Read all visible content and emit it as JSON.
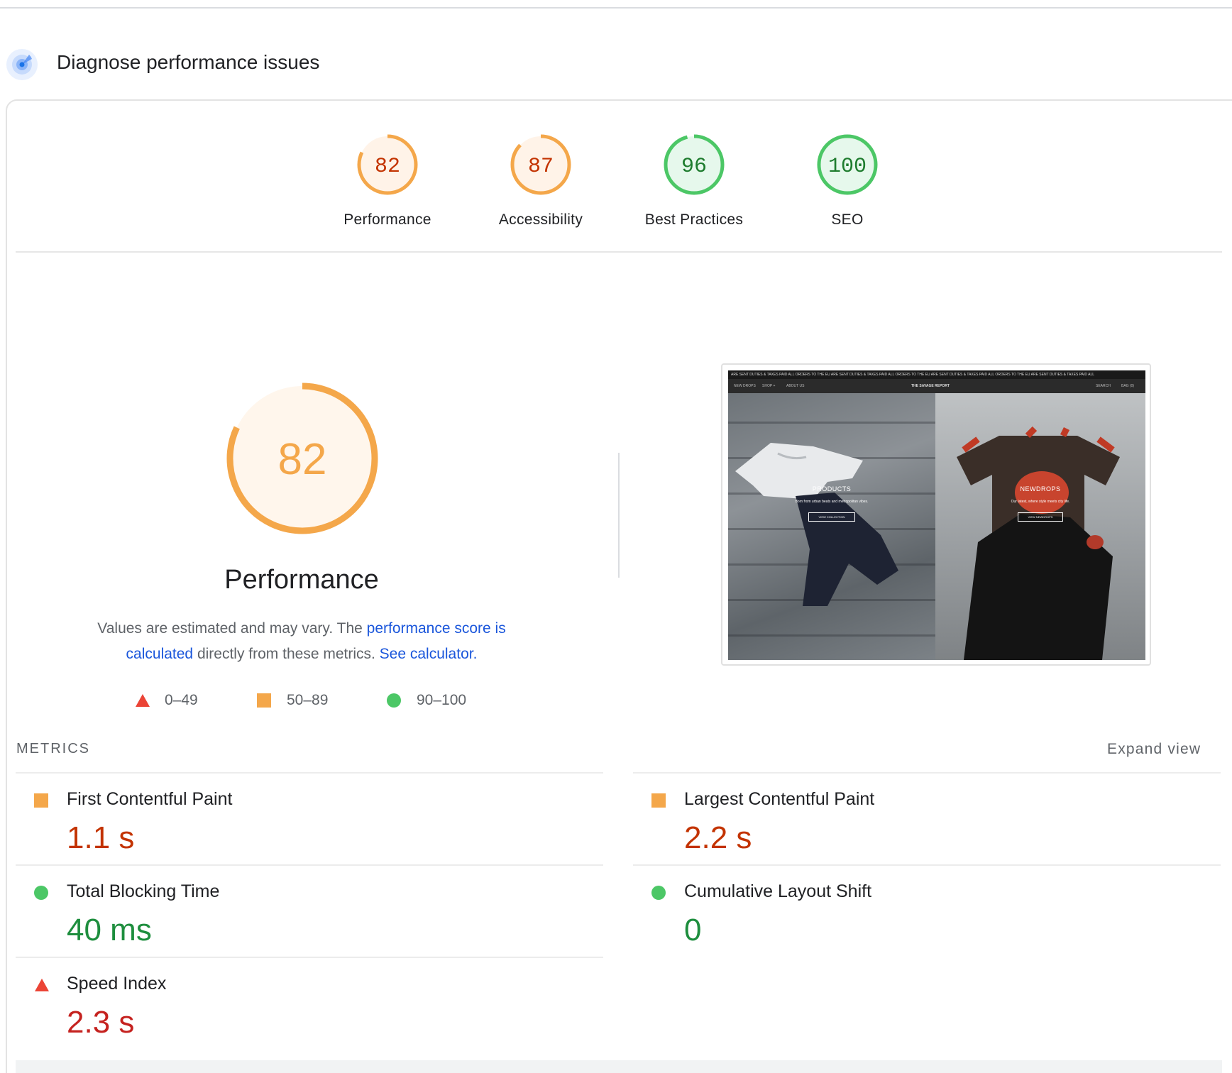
{
  "header": {
    "title": "Diagnose performance issues",
    "icon": "lighthouse-radar-icon"
  },
  "gauges": [
    {
      "score": "82",
      "label": "Performance",
      "rating": "average",
      "color": "#e8710a"
    },
    {
      "score": "87",
      "label": "Accessibility",
      "rating": "average",
      "color": "#e8710a"
    },
    {
      "score": "96",
      "label": "Best Practices",
      "rating": "pass",
      "color": "#0cce6b"
    },
    {
      "score": "100",
      "label": "SEO",
      "rating": "pass",
      "color": "#0cce6b"
    }
  ],
  "performance": {
    "score": "82",
    "title": "Performance",
    "note_prefix": "Values are estimated and may vary. The ",
    "note_link1": "performance score is calculated",
    "note_middle": " directly from these metrics. ",
    "note_link2": "See calculator."
  },
  "legend": {
    "fail": "0–49",
    "average": "50–89",
    "pass": "90–100"
  },
  "screenshot": {
    "ticker": "ARE SENT DUTIES & TAXES PAID    ALL ORDERS TO THE EU ARE SENT DUTIES & TAXES PAID    ALL ORDERS TO THE EU ARE SENT DUTIES & TAXES PAID    ALL ORDERS TO THE EU ARE SENT DUTIES & TAXES PAID    ALL",
    "nav_left_1": "NEW DROPS",
    "nav_left_2": "SHOP +",
    "nav_left_3": "ABOUT US",
    "site_title": "THE SAVAGE REPORT",
    "nav_right_1": "SEARCH",
    "nav_right_2": "BAG (0)",
    "left_heading": "PRODUCTS",
    "left_sub": "Born from urban beats and metropolitan vibes.",
    "left_button": "VIEW COLLECTION",
    "right_heading": "NEWDROPS",
    "right_sub": "Our latest, where style meets city life.",
    "right_button": "VIEW NEWDROPS"
  },
  "metrics": {
    "section_label": "METRICS",
    "expand_label": "Expand view",
    "items": [
      {
        "name": "First Contentful Paint",
        "value": "1.1 s",
        "rating": "average"
      },
      {
        "name": "Largest Contentful Paint",
        "value": "2.2 s",
        "rating": "average"
      },
      {
        "name": "Total Blocking Time",
        "value": "40 ms",
        "rating": "pass"
      },
      {
        "name": "Cumulative Layout Shift",
        "value": "0",
        "rating": "pass"
      },
      {
        "name": "Speed Index",
        "value": "2.3 s",
        "rating": "fail"
      }
    ]
  },
  "colors": {
    "average": "#f4a74a",
    "average_text": "#c33300",
    "pass": "#1e8e3e",
    "pass_fill": "#0cce6b",
    "fail": "#eb4436",
    "fail_text": "#c5221f",
    "link": "#1a56db"
  }
}
